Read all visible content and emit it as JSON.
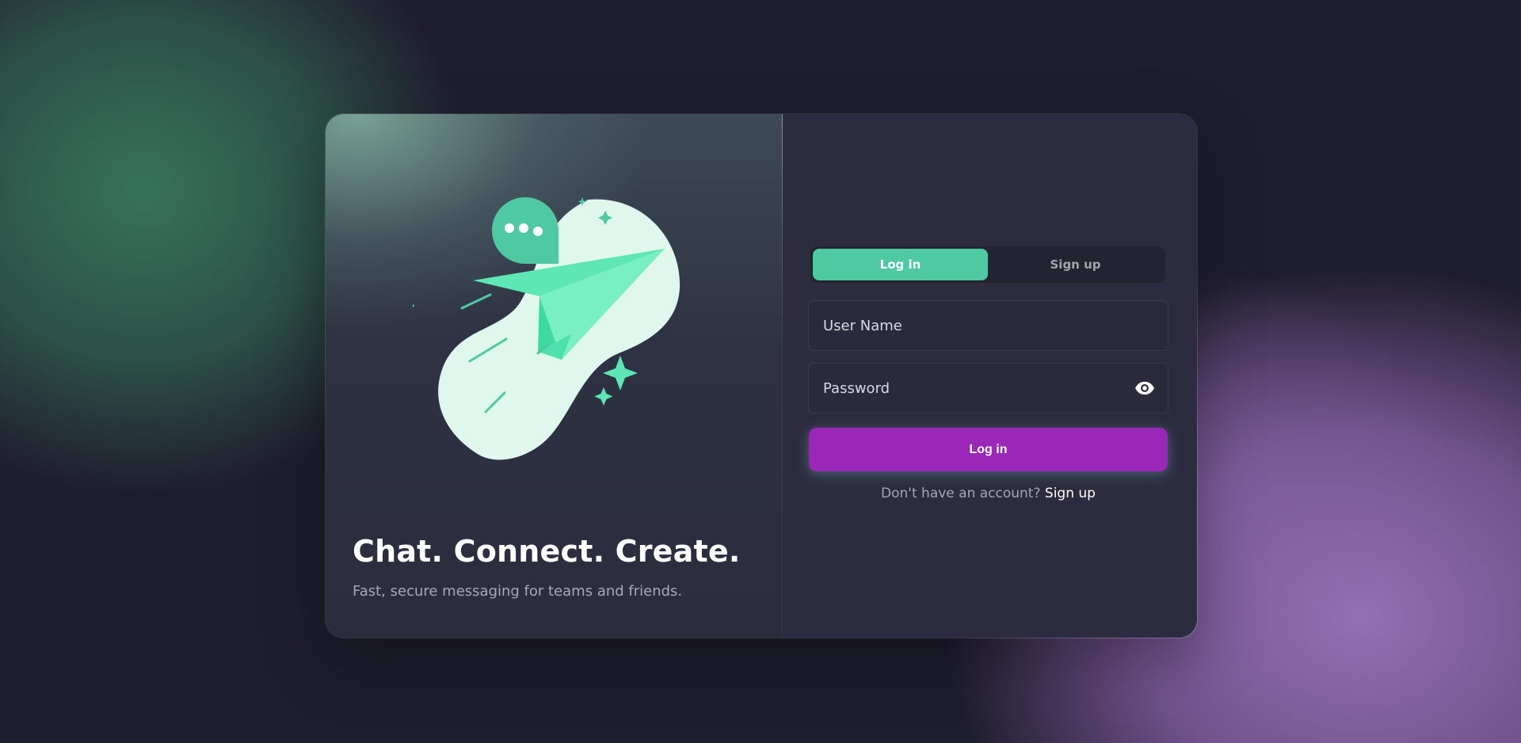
{
  "hero": {
    "headline": "Chat. Connect. Create.",
    "subline": "Fast, secure messaging for teams and friends."
  },
  "auth": {
    "tabs": [
      {
        "label": "Log in",
        "active": true
      },
      {
        "label": "Sign up",
        "active": false
      }
    ],
    "username_placeholder": "User Name",
    "password_placeholder": "Password",
    "submit_label": "Log in",
    "prompt_text": "Don't have an account?",
    "prompt_link": "Sign up"
  },
  "colors": {
    "accent_green": "#4ec9a1",
    "primary_purple": "#9b27b8",
    "card_right": "#2d2b3f",
    "page_bg": "#1f1e2e"
  },
  "icons": {
    "password_toggle": "eye-icon",
    "illustration": "paper-plane-chat-illustration"
  }
}
